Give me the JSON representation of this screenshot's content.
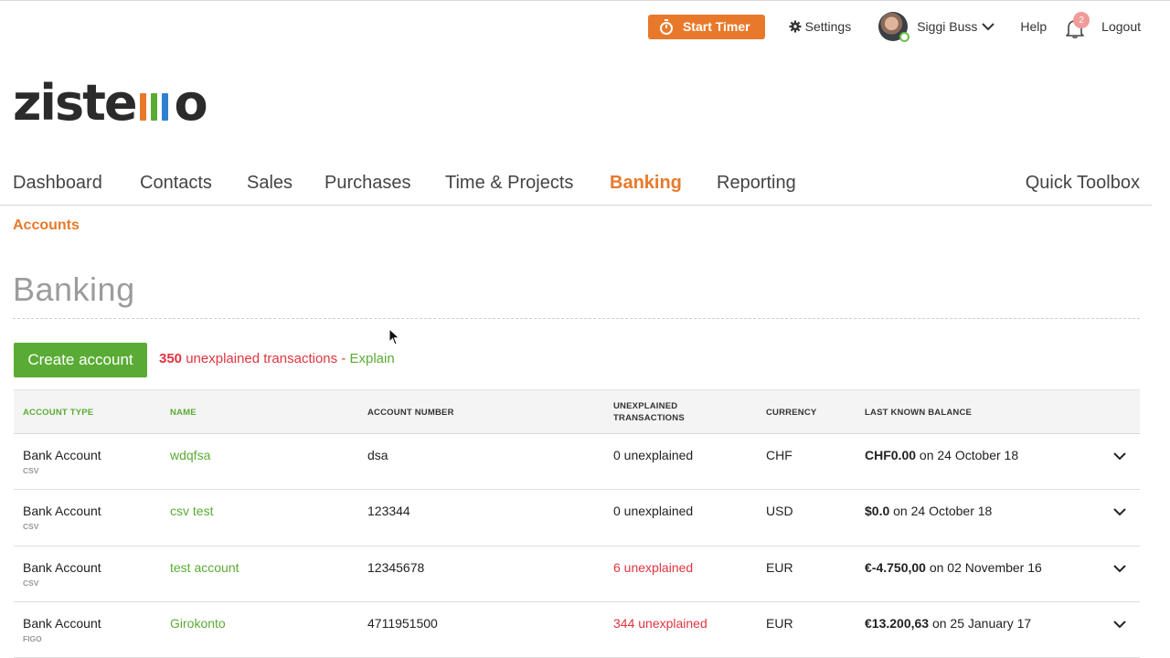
{
  "topbar": {
    "timer_label": "Start Timer",
    "settings_label": "Settings",
    "user_name": "Siggi Buss",
    "help_label": "Help",
    "notification_count": "2",
    "logout_label": "Logout"
  },
  "logo": {
    "text_left": "ziste",
    "text_right": "o",
    "bar_colors": [
      "#e8792b",
      "#5aab35",
      "#2f7fd1"
    ]
  },
  "nav": {
    "items": [
      "Dashboard",
      "Contacts",
      "Sales",
      "Purchases",
      "Time & Projects",
      "Banking",
      "Reporting"
    ],
    "active": "Banking",
    "quick_toolbox": "Quick Toolbox"
  },
  "subnav": {
    "accounts": "Accounts"
  },
  "page": {
    "title": "Banking",
    "create_button": "Create account",
    "unexplained_count": "350",
    "unexplained_text": " unexplained transactions - ",
    "explain_link": "Explain"
  },
  "table": {
    "headers": {
      "account_type": "Account Type",
      "name": "Name",
      "account_number": "Account Number",
      "unexplained_line1": "Unexplained",
      "unexplained_line2": "Transactions",
      "currency": "Currency",
      "last_known_balance": "Last Known Balance"
    },
    "rows": [
      {
        "type": "Bank Account",
        "source": "CSV",
        "name": "wdqfsa",
        "number": "dsa",
        "unexplained": "0 unexplained",
        "unexplained_alert": false,
        "currency": "CHF",
        "balance": "CHF0.00",
        "balance_date": " on 24 October 18"
      },
      {
        "type": "Bank Account",
        "source": "CSV",
        "name": "csv test",
        "number": "123344",
        "unexplained": "0 unexplained",
        "unexplained_alert": false,
        "currency": "USD",
        "balance": "$0.0",
        "balance_date": " on 24 October 18"
      },
      {
        "type": "Bank Account",
        "source": "CSV",
        "name": "test account",
        "number": "12345678",
        "unexplained": "6 unexplained",
        "unexplained_alert": true,
        "currency": "EUR",
        "balance": "€-4.750,00",
        "balance_date": " on 02 November 16"
      },
      {
        "type": "Bank Account",
        "source": "FIGO",
        "name": "Girokonto",
        "number": "4711951500",
        "unexplained": "344 unexplained",
        "unexplained_alert": true,
        "currency": "EUR",
        "balance": "€13.200,63",
        "balance_date": " on 25 January 17"
      }
    ]
  },
  "colors": {
    "brand_orange": "#e8792b",
    "brand_green": "#5aab35",
    "alert_red": "#e0343f"
  },
  "icons": {
    "timer": "stopwatch-icon",
    "settings": "gear-icon",
    "user_menu": "chevron-down-icon",
    "notifications": "bell-icon",
    "row_expand": "chevron-down-icon",
    "pointer": "mouse-cursor-icon"
  }
}
